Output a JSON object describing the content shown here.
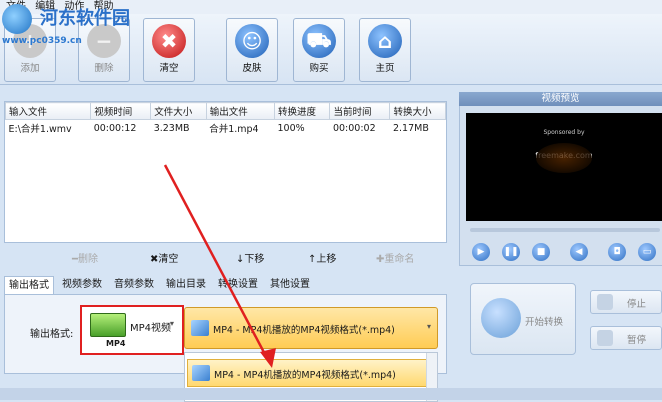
{
  "menu": [
    "文件",
    "编辑",
    "动作",
    "帮助"
  ],
  "watermark": {
    "name": "河东软件园",
    "url": "www.pc0359.cn"
  },
  "toolbar": [
    {
      "label": "添加",
      "icon": "add-icon",
      "enabled": false
    },
    {
      "label": "删除",
      "icon": "delete-icon",
      "enabled": false
    },
    {
      "label": "清空",
      "icon": "clear-icon",
      "enabled": true,
      "glyph": "✖"
    },
    {
      "label": "皮肤",
      "icon": "skin-icon",
      "enabled": true,
      "glyph": "☺"
    },
    {
      "label": "购买",
      "icon": "cart-icon",
      "enabled": true,
      "glyph": "🛒"
    },
    {
      "label": "主页",
      "icon": "home-icon",
      "enabled": true,
      "glyph": "⌂"
    }
  ],
  "table": {
    "headers": [
      "输入文件",
      "视频时间",
      "文件大小",
      "输出文件",
      "转换进度",
      "当前时间",
      "转换大小"
    ],
    "rows": [
      [
        "E:\\合并1.wmv",
        "00:00:12",
        "3.23MB",
        "合并1.mp4",
        "100%",
        "00:00:02",
        "2.17MB"
      ]
    ]
  },
  "ops": [
    {
      "label": "删除",
      "glyph": "━",
      "enabled": false
    },
    {
      "label": "清空",
      "glyph": "✖",
      "enabled": true
    },
    {
      "label": "下移",
      "glyph": "↓",
      "enabled": true
    },
    {
      "label": "上移",
      "glyph": "↑",
      "enabled": true
    },
    {
      "label": "重命名",
      "glyph": "✚",
      "enabled": false
    }
  ],
  "tabs": [
    "输出格式",
    "视频参数",
    "音频参数",
    "输出目录",
    "转换设置",
    "其他设置"
  ],
  "format": {
    "label": "输出格式:",
    "box_text": "MP4视频",
    "box_caption": "MP4",
    "selected": "MP4 - MP4机播放的MP4视频格式(*.mp4)",
    "list_item": "MP4 - MP4机播放的MP4视频格式(*.mp4)"
  },
  "preview": {
    "title": "视频预览",
    "screen_line1": "Sponsored by",
    "screen_brand": "freemake.com"
  },
  "actions": {
    "start": "开始转换",
    "stop": "停止",
    "pause": "暂停"
  },
  "colors": {
    "highlight": "#e02020",
    "accent": "#2a70c9"
  }
}
